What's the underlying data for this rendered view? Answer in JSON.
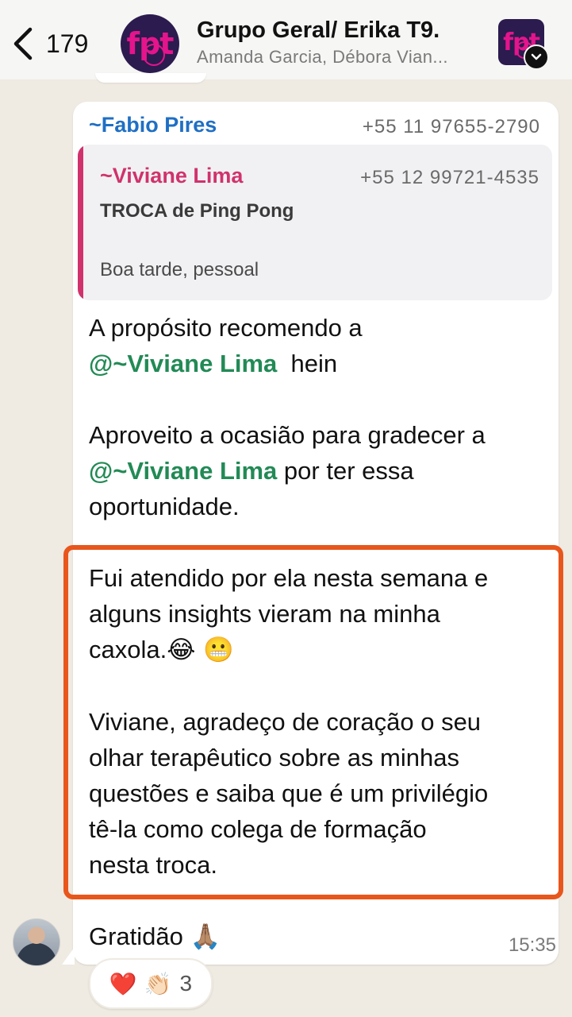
{
  "header": {
    "back_count": "179",
    "title": "Grupo Geral/ Erika T9.",
    "subtitle": "Amanda Garcia, Débora Vian...",
    "avatar_text": "fpt"
  },
  "message": {
    "sender": "~Fabio Pires",
    "sender_phone": "+55 11 97655-2790",
    "quote": {
      "name": "~Viviane Lima",
      "phone": "+55 12 99721-4535",
      "line1": "TROCA de Ping Pong",
      "line2": "Boa tarde, pessoal"
    },
    "p1_line1": "A propósito recomendo a",
    "p1_mention": "@~Viviane Lima",
    "p1_tail": "  hein",
    "p2_line1": "Aproveito a ocasião para gradecer a",
    "p2_mention": "@~Viviane Lima",
    "p2_tail": " por ter essa",
    "p2_line3": "oportunidade.",
    "p3_line1": "Fui atendido por ela nesta semana e",
    "p3_line2": "alguns insights vieram na minha",
    "p3_line3": "caxola.",
    "p3_emojis": "😂 😬",
    "p4_line1": "Viviane, agradeço de coração o seu",
    "p4_line2": "olhar terapêutico sobre as minhas",
    "p4_line3": "questões e saiba que é um privilégio",
    "p4_line4": "tê-la como colega de formação",
    "p4_line5": "nesta troca.",
    "p5_text": "Gratidão",
    "p5_emoji": "🙏🏽",
    "time": "15:35"
  },
  "reactions": {
    "emojis": "❤️ 👏🏻",
    "count": "3"
  },
  "colors": {
    "highlight_border": "#E8561C",
    "mention": "#228A55",
    "sender": "#1F6FC4",
    "quote_accent": "#D0326C"
  }
}
